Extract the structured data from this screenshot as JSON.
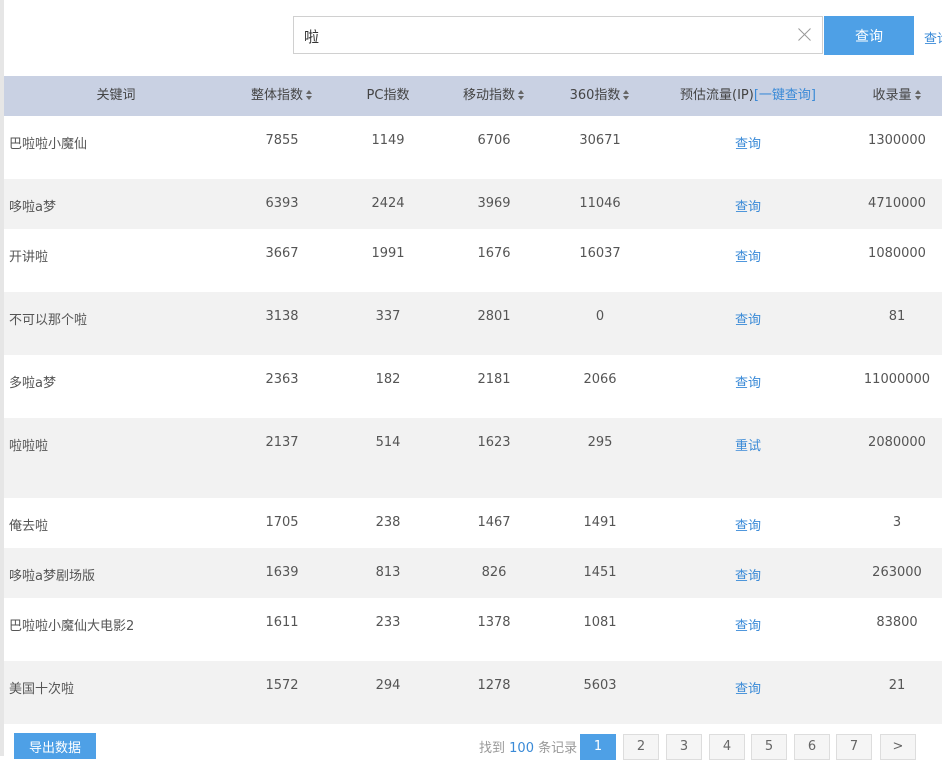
{
  "search": {
    "value": "啦",
    "button_label": "查询",
    "side_link": "查询"
  },
  "table": {
    "headers": {
      "keyword": "关键词",
      "overall": "整体指数",
      "pc": "PC指数",
      "mobile": "移动指数",
      "index360": "360指数",
      "traffic": "预估流量(IP)",
      "traffic_link": "[一键查询]",
      "indexed": "收录量"
    },
    "rows": [
      {
        "keyword": "巴啦啦小魔仙",
        "overall": "7855",
        "pc": "1149",
        "mobile": "6706",
        "i360": "30671",
        "action": "查询",
        "indexed": "1300000"
      },
      {
        "keyword": "哆啦a梦",
        "overall": "6393",
        "pc": "2424",
        "mobile": "3969",
        "i360": "11046",
        "action": "查询",
        "indexed": "4710000"
      },
      {
        "keyword": "开讲啦",
        "overall": "3667",
        "pc": "1991",
        "mobile": "1676",
        "i360": "16037",
        "action": "查询",
        "indexed": "1080000"
      },
      {
        "keyword": "不可以那个啦",
        "overall": "3138",
        "pc": "337",
        "mobile": "2801",
        "i360": "0",
        "action": "查询",
        "indexed": "81"
      },
      {
        "keyword": "多啦a梦",
        "overall": "2363",
        "pc": "182",
        "mobile": "2181",
        "i360": "2066",
        "action": "查询",
        "indexed": "11000000"
      },
      {
        "keyword": "啦啦啦",
        "overall": "2137",
        "pc": "514",
        "mobile": "1623",
        "i360": "295",
        "action": "重试",
        "indexed": "2080000"
      },
      {
        "keyword": "俺去啦",
        "overall": "1705",
        "pc": "238",
        "mobile": "1467",
        "i360": "1491",
        "action": "查询",
        "indexed": "3"
      },
      {
        "keyword": "哆啦a梦剧场版",
        "overall": "1639",
        "pc": "813",
        "mobile": "826",
        "i360": "1451",
        "action": "查询",
        "indexed": "263000"
      },
      {
        "keyword": "巴啦啦小魔仙大电影2",
        "overall": "1611",
        "pc": "233",
        "mobile": "1378",
        "i360": "1081",
        "action": "查询",
        "indexed": "83800"
      },
      {
        "keyword": "美国十次啦",
        "overall": "1572",
        "pc": "294",
        "mobile": "1278",
        "i360": "5603",
        "action": "查询",
        "indexed": "21"
      }
    ]
  },
  "footer": {
    "export_label": "导出数据",
    "found_prefix": "找到",
    "found_count": "100",
    "found_suffix": "条记录",
    "pages": [
      "1",
      "2",
      "3",
      "4",
      "5",
      "6",
      "7",
      ">"
    ],
    "current_page": "1"
  },
  "colors": {
    "accent": "#4ea0e6",
    "header_bg": "#c9d1e3",
    "link": "#3a8ad7",
    "stripe": "#f2f2f2"
  }
}
